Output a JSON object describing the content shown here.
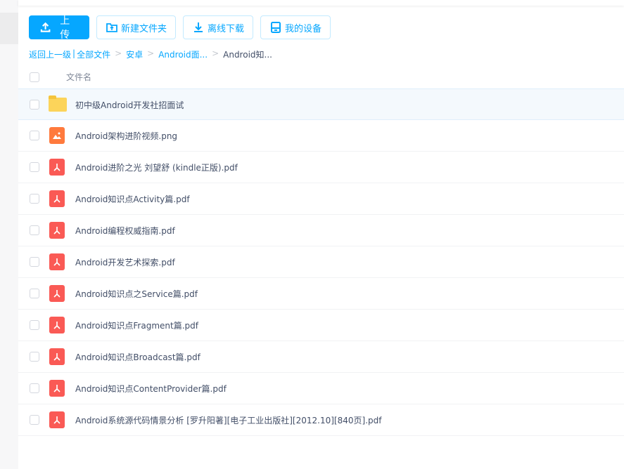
{
  "toolbar": {
    "upload": "上传",
    "new_folder": "新建文件夹",
    "offline_download": "离线下载",
    "my_devices": "我的设备"
  },
  "breadcrumb": {
    "back": "返回上一级",
    "sep_bar": "|",
    "all_files": "全部文件",
    "sep": ">",
    "items": [
      "安卓",
      "Android面...",
      "Android知..."
    ]
  },
  "list": {
    "header": "文件名",
    "files": [
      {
        "name": "初中级Android开发社招面试",
        "type": "folder"
      },
      {
        "name": "Android架构进阶视频.png",
        "type": "png"
      },
      {
        "name": "Android进阶之光 刘望舒 (kindle正版).pdf",
        "type": "pdf"
      },
      {
        "name": "Android知识点Activity篇.pdf",
        "type": "pdf"
      },
      {
        "name": "Android编程权威指南.pdf",
        "type": "pdf"
      },
      {
        "name": "Android开发艺术探索.pdf",
        "type": "pdf"
      },
      {
        "name": "Android知识点之Service篇.pdf",
        "type": "pdf"
      },
      {
        "name": "Android知识点Fragment篇.pdf",
        "type": "pdf"
      },
      {
        "name": "Android知识点Broadcast篇.pdf",
        "type": "pdf"
      },
      {
        "name": "Android知识点ContentProvider篇.pdf",
        "type": "pdf"
      },
      {
        "name": "Android系统源代码情景分析 [罗升阳著][电子工业出版社][2012.10][840页].pdf",
        "type": "pdf"
      }
    ]
  },
  "colors": {
    "accent": "#06a7ff",
    "pdf": "#fa5a55",
    "png": "#ff7a3d",
    "folder": "#fcd45a"
  }
}
